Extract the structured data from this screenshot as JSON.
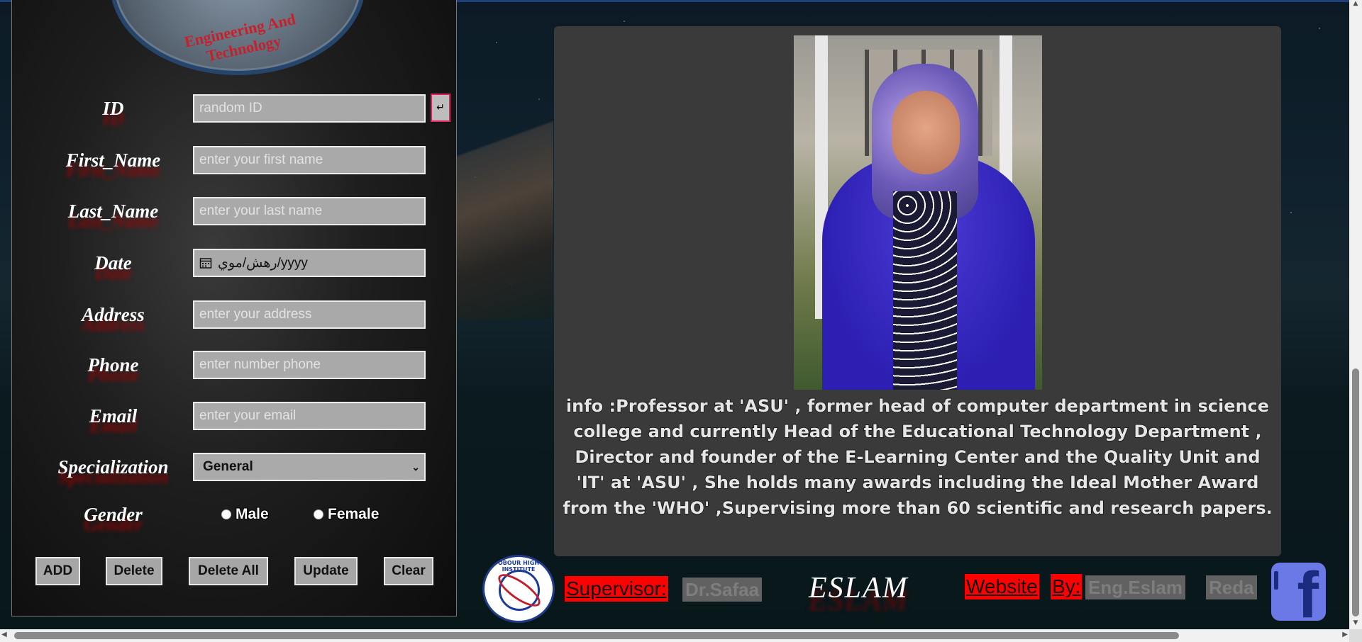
{
  "form": {
    "logo_text": "Engineering And Technology",
    "id": {
      "label": "ID",
      "placeholder": "random ID",
      "button_icon": "↵"
    },
    "first_name": {
      "label": "First_Name",
      "placeholder": "enter your first name"
    },
    "last_name": {
      "label": "Last_Name",
      "placeholder": "enter your last name"
    },
    "date": {
      "label": "Date",
      "display": "رهش/موي/yyyy"
    },
    "address": {
      "label": "Address",
      "placeholder": "enter your address"
    },
    "phone": {
      "label": "Phone",
      "placeholder": "enter number phone"
    },
    "email": {
      "label": "Email",
      "placeholder": "enter your email"
    },
    "specialization": {
      "label": "Specialization",
      "selected": "General"
    },
    "gender": {
      "label": "Gender",
      "options": [
        "Male",
        "Female"
      ]
    },
    "buttons": {
      "add": "ADD",
      "delete": "Delete",
      "delete_all": "Delete All",
      "update": "Update",
      "clear": "Clear"
    }
  },
  "profile": {
    "info": "info :Professor at 'ASU' , former head of computer department in science college and currently Head of the Educational Technology Department , Director and founder of the E-Learning Center and the Quality Unit and 'IT' at 'ASU' , She holds many awards including the Ideal Mother Award from the 'WHO' ,Supervising more than 60 scientific and research papers."
  },
  "footer": {
    "logo_text": "OBOUR HIGH INSTITUTE",
    "supervisor_label": "Supervisor:",
    "supervisor_name": "Dr.Safaa",
    "signature": "ESLAM",
    "website_label": "Website",
    "by_label": "By:",
    "author_first": "Eng.Eslam",
    "author_last": "Reda"
  },
  "colors": {
    "accent_red": "#ff0000",
    "facebook_blue": "#6a79e6",
    "panel_dark": "#1e1e1e",
    "card_bg": "#3a3a3a"
  },
  "icons": [
    "enter-icon",
    "calendar-icon",
    "chevron-down-icon",
    "facebook-icon"
  ]
}
